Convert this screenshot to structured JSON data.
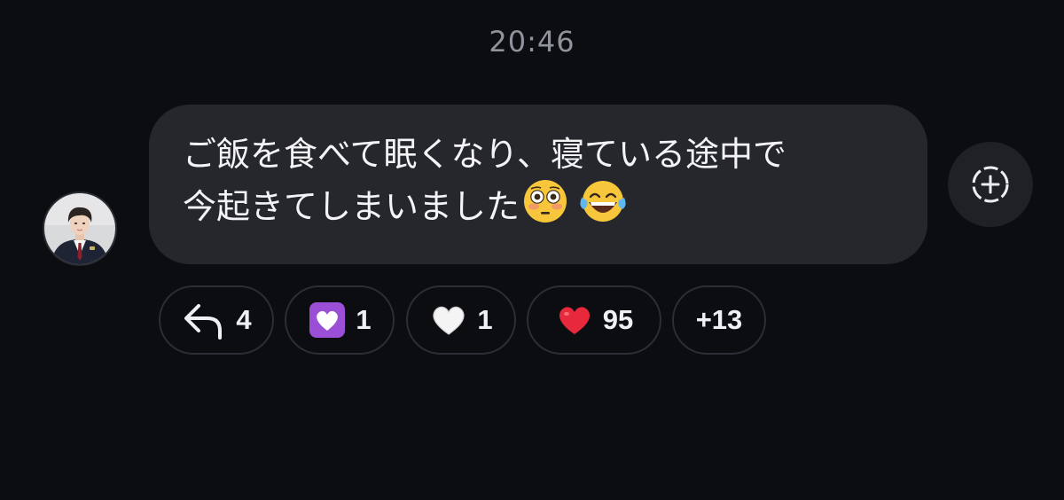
{
  "conversation": {
    "timestamp": "20:46"
  },
  "message": {
    "sender_avatar": "avatar",
    "lines": [
      "ご飯を食べて眠くなり、寝ている途中で",
      "今起きてしまいました"
    ],
    "trailing_emoji": [
      "flushed-face-icon",
      "tears-of-joy-icon"
    ],
    "bubble_color": "#25272c"
  },
  "add_reaction": {
    "icon": "add-reaction-icon"
  },
  "reactions": {
    "reply": {
      "icon": "reply-arrow-icon",
      "count": "4"
    },
    "purple_heart": {
      "icon": "heart-with-ribbon-icon",
      "count": "1"
    },
    "white_heart": {
      "icon": "white-heart-icon",
      "count": "1"
    },
    "red_heart": {
      "icon": "red-heart-icon",
      "count": "95"
    },
    "more": {
      "label": "+13"
    }
  },
  "colors": {
    "background": "#0b0d11",
    "timestamp": "#8f939b",
    "chip_border": "#2b2e34"
  }
}
